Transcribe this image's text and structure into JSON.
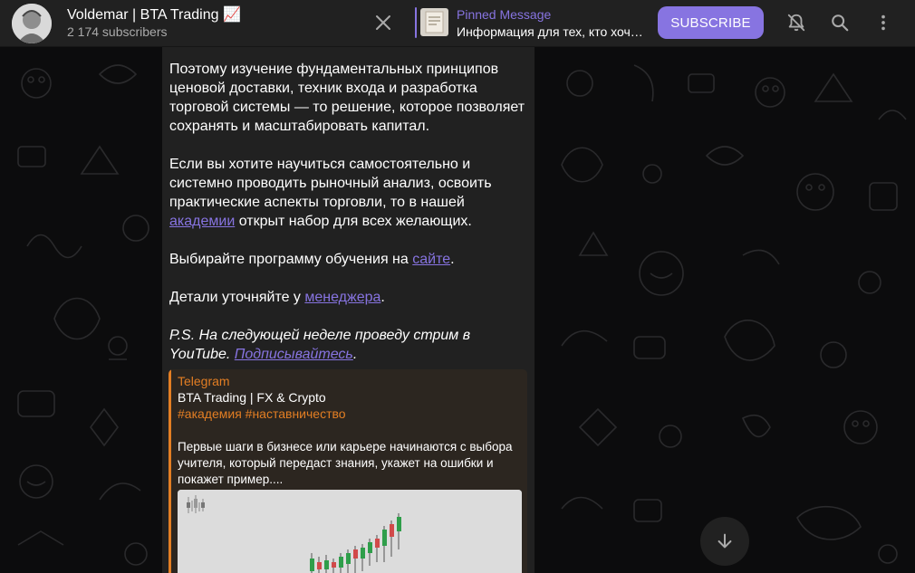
{
  "header": {
    "channel_title": "Voldemar | BTA Trading 📈",
    "subscribers": "2 174 subscribers",
    "pinned_label": "Pinned Message",
    "pinned_text": "Информация для тех, кто хочет...",
    "subscribe_label": "SUBSCRIBE"
  },
  "message": {
    "p1": "Поэтому изучение фундаментальных принципов ценовой доставки, техник входа и разработка торговой системы — то решение, которое позволяет сохранять и масштабировать капитал.",
    "p2_before": "Если вы хотите научиться самостоятельно и системно проводить рыночный анализ, освоить практические аспекты торговли, то в нашей ",
    "p2_link": "академии",
    "p2_after": " открыт набор для всех желающих.",
    "p3_before": "Выбирайте программу обучения на ",
    "p3_link": "сайте",
    "p3_after": ".",
    "p4_before": "Детали уточняйте у ",
    "p4_link": "менеджера",
    "p4_after": ".",
    "p5_before": "P.S. На следующей неделе проведу стрим в YouTube. ",
    "p5_link": "Подписывайтесь",
    "p5_after": "."
  },
  "preview": {
    "site": "Telegram",
    "title": "BTA Trading | FX & Crypto",
    "tags": "#академия #наставничество",
    "description": "Первые шаги в бизнесе или карьере начинаются с выбора учителя, который передаст знания, укажет на ошибки и покажет пример...."
  },
  "colors": {
    "accent": "#8774e1",
    "panel": "#212121",
    "preview_accent": "#e37e23"
  },
  "icons": {
    "close": "close-icon",
    "mute": "bell-off-icon",
    "search": "search-icon",
    "more": "more-vertical-icon",
    "scroll": "arrow-down-icon"
  }
}
